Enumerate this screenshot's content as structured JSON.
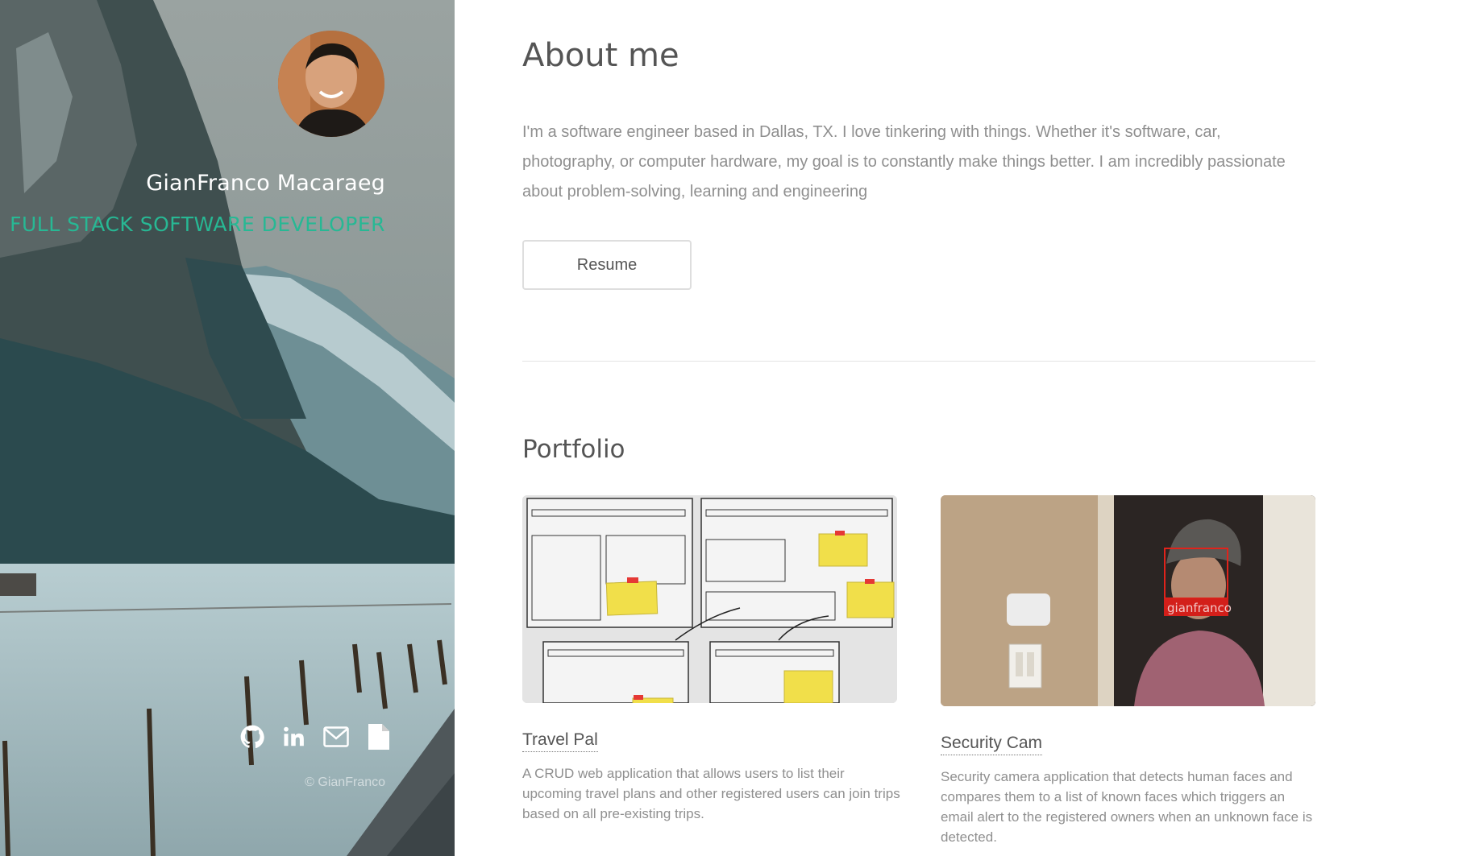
{
  "sidebar": {
    "name": "GianFranco Macaraeg",
    "role": "FULL STACK SOFTWARE DEVELOPER",
    "copyright": "© GianFranco",
    "social": [
      {
        "icon": "github-icon"
      },
      {
        "icon": "linkedin-icon"
      },
      {
        "icon": "mail-icon"
      },
      {
        "icon": "document-icon"
      }
    ]
  },
  "about": {
    "title": "About me",
    "text": "I'm a software engineer based in Dallas, TX. I love tinkering with things. Whether it's software, car, photography, or computer hardware, my goal is to constantly make things better. I am incredibly passionate about problem-solving, learning and engineering",
    "resume_label": "Resume"
  },
  "portfolio": {
    "title": "Portfolio",
    "projects": [
      {
        "title": "Travel Pal",
        "description": "A CRUD web application that allows users to list their upcoming travel plans and other registered users can join trips based on all pre-existing trips."
      },
      {
        "title": "Security Cam",
        "description": "Security camera application that detects human faces and compares them to a list of known faces which triggers an email alert to the registered owners when an unknown face is detected.",
        "face_label": "gianfranco"
      }
    ]
  },
  "colors": {
    "accent": "#27b894",
    "text": "#555555",
    "muted": "#8f8f8f"
  }
}
